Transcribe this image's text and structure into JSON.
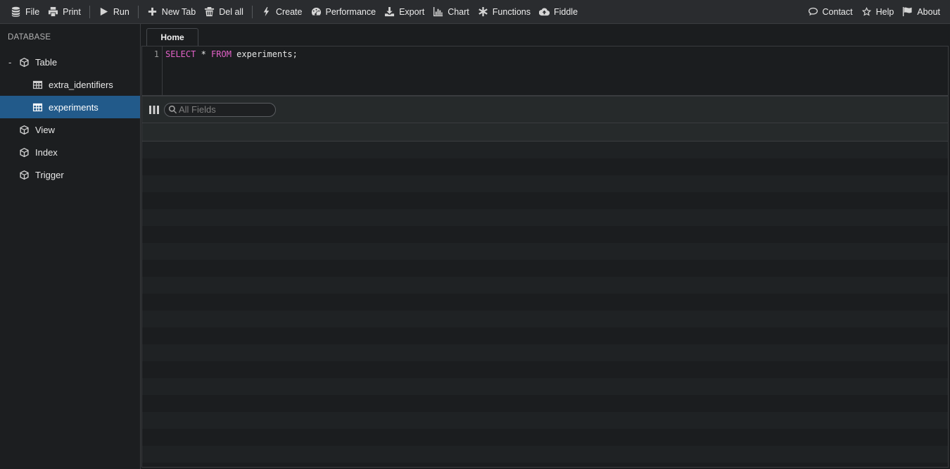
{
  "toolbar": {
    "left": [
      {
        "label": "File",
        "icon": "database-icon"
      },
      {
        "label": "Print",
        "icon": "printer-icon"
      },
      {
        "label": "Run",
        "icon": "play-icon"
      },
      {
        "label": "New Tab",
        "icon": "plus-icon"
      },
      {
        "label": "Del all",
        "icon": "trash-icon"
      },
      {
        "label": "Create",
        "icon": "bolt-icon"
      },
      {
        "label": "Performance",
        "icon": "gauge-icon"
      },
      {
        "label": "Export",
        "icon": "download-icon"
      },
      {
        "label": "Chart",
        "icon": "bar-chart-icon"
      },
      {
        "label": "Functions",
        "icon": "asterisk-icon"
      },
      {
        "label": "Fiddle",
        "icon": "cloud-upload-icon"
      }
    ],
    "right": [
      {
        "label": "Contact",
        "icon": "chat-icon"
      },
      {
        "label": "Help",
        "icon": "star-icon"
      },
      {
        "label": "About",
        "icon": "flag-icon"
      }
    ]
  },
  "sidebar": {
    "header": "DATABASE",
    "table_group": {
      "toggle": "-",
      "label": "Table",
      "icon": "cube-icon"
    },
    "tables": [
      {
        "label": "extra_identifiers",
        "icon": "table-icon",
        "active": false
      },
      {
        "label": "experiments",
        "icon": "table-icon",
        "active": true
      }
    ],
    "groups": [
      {
        "label": "View",
        "icon": "cube-icon"
      },
      {
        "label": "Index",
        "icon": "cube-icon"
      },
      {
        "label": "Trigger",
        "icon": "cube-icon"
      }
    ]
  },
  "main": {
    "tab_label": "Home",
    "editor": {
      "line_number": "1",
      "kw_select": "SELECT",
      "star": " * ",
      "kw_from": "FROM",
      "rest": " experiments;"
    },
    "results": {
      "search_placeholder": "All Fields",
      "columns_icon": "columns-icon",
      "search_icon": "search-icon"
    }
  },
  "colors": {
    "background": "#1b1d1f",
    "toolbar": "#2a2c2f",
    "active_item": "#225a8a",
    "keyword": "#e462c9"
  }
}
